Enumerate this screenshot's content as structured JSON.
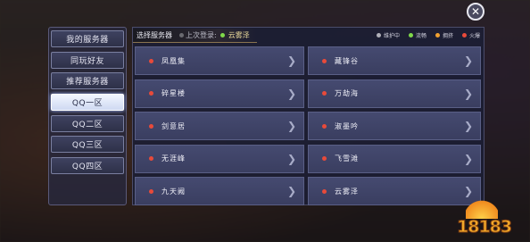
{
  "colors": {
    "maintenance": "#b0b0b8",
    "smooth": "#7fd84a",
    "busy": "#f0a030",
    "full": "#e84a3a"
  },
  "close": {
    "icon": "close-icon",
    "glyph": "✕"
  },
  "sidebar": {
    "items": [
      {
        "label": "我的服务器",
        "active": false
      },
      {
        "label": "同玩好友",
        "active": false
      },
      {
        "label": "推荐服务器",
        "active": false
      },
      {
        "label": "QQ一区",
        "active": true
      },
      {
        "label": "QQ二区",
        "active": false
      },
      {
        "label": "QQ三区",
        "active": false
      },
      {
        "label": "QQ四区",
        "active": false
      }
    ]
  },
  "header": {
    "title": "选择服务器",
    "last_login_label": "上次登录:",
    "last_login_server": "云雾泽"
  },
  "legend": [
    {
      "label": "维护中",
      "status": "maintenance"
    },
    {
      "label": "流畅",
      "status": "smooth"
    },
    {
      "label": "拥挤",
      "status": "busy"
    },
    {
      "label": "火爆",
      "status": "full"
    }
  ],
  "servers": [
    {
      "name": "凤凰集",
      "status": "full"
    },
    {
      "name": "藏锋谷",
      "status": "full"
    },
    {
      "name": "碎星楼",
      "status": "full"
    },
    {
      "name": "万劫海",
      "status": "full"
    },
    {
      "name": "剑意居",
      "status": "full"
    },
    {
      "name": "淑墨吟",
      "status": "full"
    },
    {
      "name": "无涯峰",
      "status": "full"
    },
    {
      "name": "飞雪滩",
      "status": "full"
    },
    {
      "name": "九天阙",
      "status": "full"
    },
    {
      "name": "云雾泽",
      "status": "full"
    }
  ],
  "watermark": {
    "text": "18183"
  }
}
